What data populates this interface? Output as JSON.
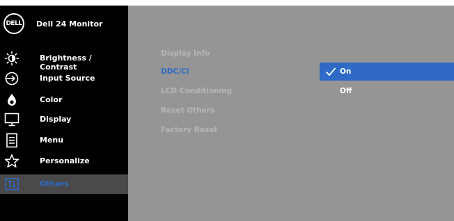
{
  "header": {
    "brand": "DELL",
    "model": "Dell 24 Monitor"
  },
  "nav": [
    {
      "label": "Brightness / Contrast",
      "icon": "brightness-icon",
      "active": false
    },
    {
      "label": "Input Source",
      "icon": "input-source-icon",
      "active": false
    },
    {
      "label": "Color",
      "icon": "color-icon",
      "active": false
    },
    {
      "label": "Display",
      "icon": "display-icon",
      "active": false
    },
    {
      "label": "Menu",
      "icon": "menu-icon",
      "active": false
    },
    {
      "label": "Personalize",
      "icon": "star-icon",
      "active": false
    },
    {
      "label": "Others",
      "icon": "others-icon",
      "active": true
    }
  ],
  "submenu": [
    {
      "label": "Display Info",
      "selected": false
    },
    {
      "label": "DDC/CI",
      "selected": true
    },
    {
      "label": "LCD Conditioning",
      "selected": false
    },
    {
      "label": "Reset Others",
      "selected": false
    },
    {
      "label": "Factory Reset",
      "selected": false
    }
  ],
  "options": [
    {
      "label": "On",
      "checked": true,
      "highlighted": true
    },
    {
      "label": "Off",
      "checked": false,
      "highlighted": false
    }
  ],
  "colors": {
    "accent": "#2e6ac6",
    "panel": "#959596",
    "sidebar": "#000000",
    "active_row": "#4a4a4b"
  }
}
